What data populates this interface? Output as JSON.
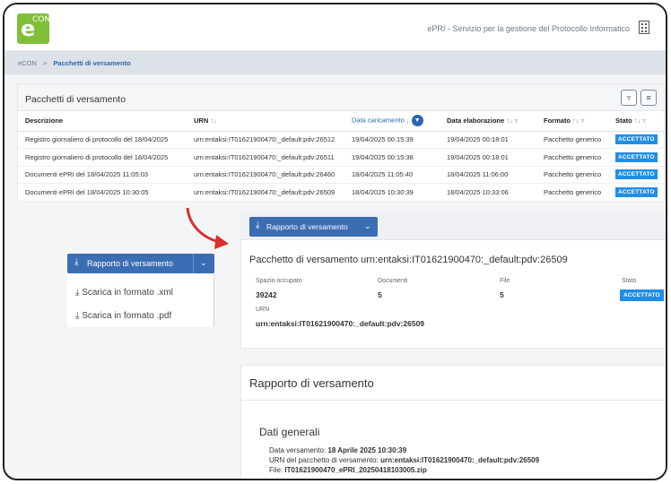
{
  "app": {
    "logo_letter": "e",
    "logo_sup": "CON",
    "title": "ePRI - Servizio per la gestione del Protocollo Informatico",
    "brand_color": "#7fbf3a",
    "accent_color": "#3b6db3"
  },
  "breadcrumb": {
    "root": "eCON",
    "separator": ">",
    "current": "Pacchetti di versamento"
  },
  "table": {
    "title": "Pacchetti di versamento",
    "columns": [
      "Descrizione",
      "URN",
      "Data caricamento",
      "Data elaborazione",
      "Formato",
      "Stato"
    ],
    "rows": [
      {
        "descrizione": "Registro giornaliero di protocollo del 18/04/2025",
        "urn": "urn:entaksi:IT01621900470:_default:pdv:26512",
        "caricamento": "19/04/2025 00:15:39",
        "elaborazione": "19/04/2025 00:18:01",
        "formato": "Pacchetto generico",
        "stato": "ACCETTATO"
      },
      {
        "descrizione": "Registro giornaliero di protocollo del 18/04/2025",
        "urn": "urn:entaksi:IT01621900470:_default:pdv:26511",
        "caricamento": "19/04/2025 00:15:38",
        "elaborazione": "19/04/2025 00:18:01",
        "formato": "Pacchetto generico",
        "stato": "ACCETTATO"
      },
      {
        "descrizione": "Documenti ePRI del 18/04/2025 11:05:03",
        "urn": "urn:entaksi:IT01621900470:_default:pdv:26460",
        "caricamento": "18/04/2025 11:05:40",
        "elaborazione": "18/04/2025 11:06:00",
        "formato": "Pacchetto generico",
        "stato": "ACCETTATO"
      },
      {
        "descrizione": "Documenti ePRI del 18/04/2025 10:30:05",
        "urn": "urn:entaksi:IT01621900470:_default:pdv:26509",
        "caricamento": "18/04/2025 10:30:39",
        "elaborazione": "18/04/2025 10:33:06",
        "formato": "Pacchetto generico",
        "stato": "ACCETTATO"
      }
    ]
  },
  "rapporto_button": {
    "label": "Rapporto di versamento"
  },
  "menu": {
    "items": [
      "Scarica in formato .xml",
      "Scarica in formato .pdf"
    ]
  },
  "detail": {
    "title": "Pacchetto di versamento urn:entaksi:IT01621900470:_default:pdv:26509",
    "spazio_label": "Spazio occupato",
    "spazio_value": "39242",
    "documenti_label": "Documenti",
    "documenti_value": "5",
    "file_label": "File",
    "file_value": "5",
    "stato_label": "Stato",
    "stato_value": "ACCETTATO",
    "urn_label": "URN",
    "urn_value": "urn:entaksi:IT01621900470:_default:pdv:26509"
  },
  "report": {
    "title": "Rapporto di versamento",
    "section_title": "Dati generali",
    "data_label": "Data versamento:",
    "data_value": "18 Aprile 2025 10:30:39",
    "urn_label": "URN del pacchetto di versamento:",
    "urn_value": "urn:entaksi:IT01621900470:_default:pdv:26509",
    "file_label": "File:",
    "file_value": "IT01621900470_ePRI_20250418103005.zip"
  }
}
